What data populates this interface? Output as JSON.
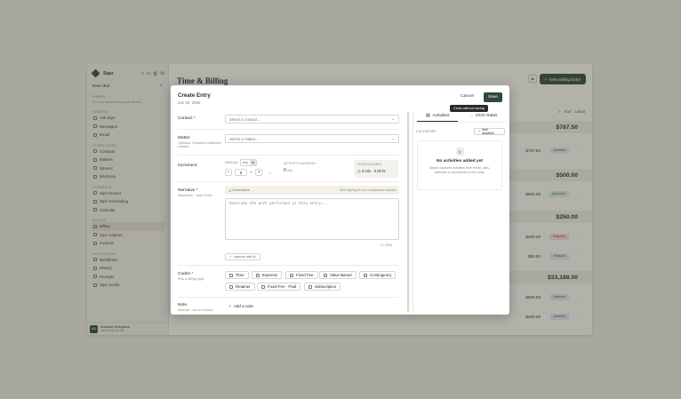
{
  "app": {
    "brand": "Sqsr",
    "new_chat": "New chat",
    "sections": {
      "pinned": "Pinned",
      "pinned_hint": "Pin your favorites for quick access",
      "general": "General",
      "client_work": "Client work",
      "schedule": "Schedule",
      "billing": "Billing",
      "automation": "Automation"
    },
    "nav_general": [
      "Ask Sqsr",
      "Messages",
      "Email"
    ],
    "nav_client": [
      "Contacts",
      "Matters",
      "Spaces",
      "Briefcase"
    ],
    "nav_schedule": [
      "Sqsr Docket",
      "Sqsr Scheduling",
      "Calendar"
    ],
    "nav_billing": [
      "Billing",
      "Sqsr Capture",
      "Invoices"
    ],
    "nav_auto": [
      "Workflows",
      "History",
      "Prompts",
      "Sqsr Scribe"
    ],
    "user": {
      "initials": "AU",
      "name": "Annalise Umugisha",
      "email": "annalise@sqsr.law"
    },
    "page_title": "Time & Billing",
    "new_entry_button": "New Billing Entry",
    "sort_label": "Sort",
    "sort_value": "Latest",
    "group_totals": [
      "$787.50",
      "$500.00",
      "$250.00",
      "$33,188.00"
    ],
    "rows": [
      {
        "amount": "$787.50",
        "status": "Invoiced"
      },
      {
        "amount": "$500.00",
        "status": "Approved"
      },
      {
        "amount": "$200.00",
        "status": "Disputed"
      },
      {
        "amount": "$50.00",
        "status": "Invoiced"
      },
      {
        "amount": "$500.00",
        "status": "Invoiced"
      },
      {
        "amount": "$200.00",
        "status": "Invoiced"
      }
    ]
  },
  "modal": {
    "title": "Create Entry",
    "date": "Jun 19, 2026",
    "cancel": "Cancel",
    "save": "Save",
    "tooltip": "Close without saving",
    "contact_label": "Contact *",
    "contact_placeholder": "Select a contact...",
    "matter_label": "Matter",
    "matter_hint": "Optional. Scoped to selected contact.",
    "matter_placeholder": "Select a matter...",
    "increment_label": "Increment",
    "mode_label": "Manual",
    "mode_options": [
      "min",
      "hr"
    ],
    "activity_duration_label": "Activity duration",
    "stepper_value": "0",
    "stepper_unit": "hr",
    "duration_value": "0",
    "duration_unit": "min",
    "total_billable_label": "Total billable",
    "total_billable_value": "0 min · 0.00 hr",
    "narrative_label": "Narrative *",
    "narrative_hint": "Markdown · max 2,000",
    "banner_left": "Corrections",
    "banner_right": "Start typing to run compliance checks",
    "narrative_placeholder": "Describe the work performed in this entry...",
    "char_count": "0 / 2000",
    "improve_button": "Improve with AI",
    "codes_label": "Codes *",
    "codes_hint": "Pick a billing type",
    "codes": [
      "Time",
      "Expense",
      "Fixed Fee",
      "Value Based",
      "Contingency",
      "Retainer",
      "Fixed Fee · Paid",
      "Subscription"
    ],
    "note_label": "Note",
    "note_hint": "Internal · not on invoice",
    "add_note": "Add a note",
    "tabs": [
      "Activities",
      "OCG Rules"
    ],
    "activities_count": "0 Activities",
    "add_activities": "Add activities",
    "empty_title": "No activities added yet",
    "empty_desc": "Attach captured activities from email, calls, calendar or documents to this entry."
  }
}
